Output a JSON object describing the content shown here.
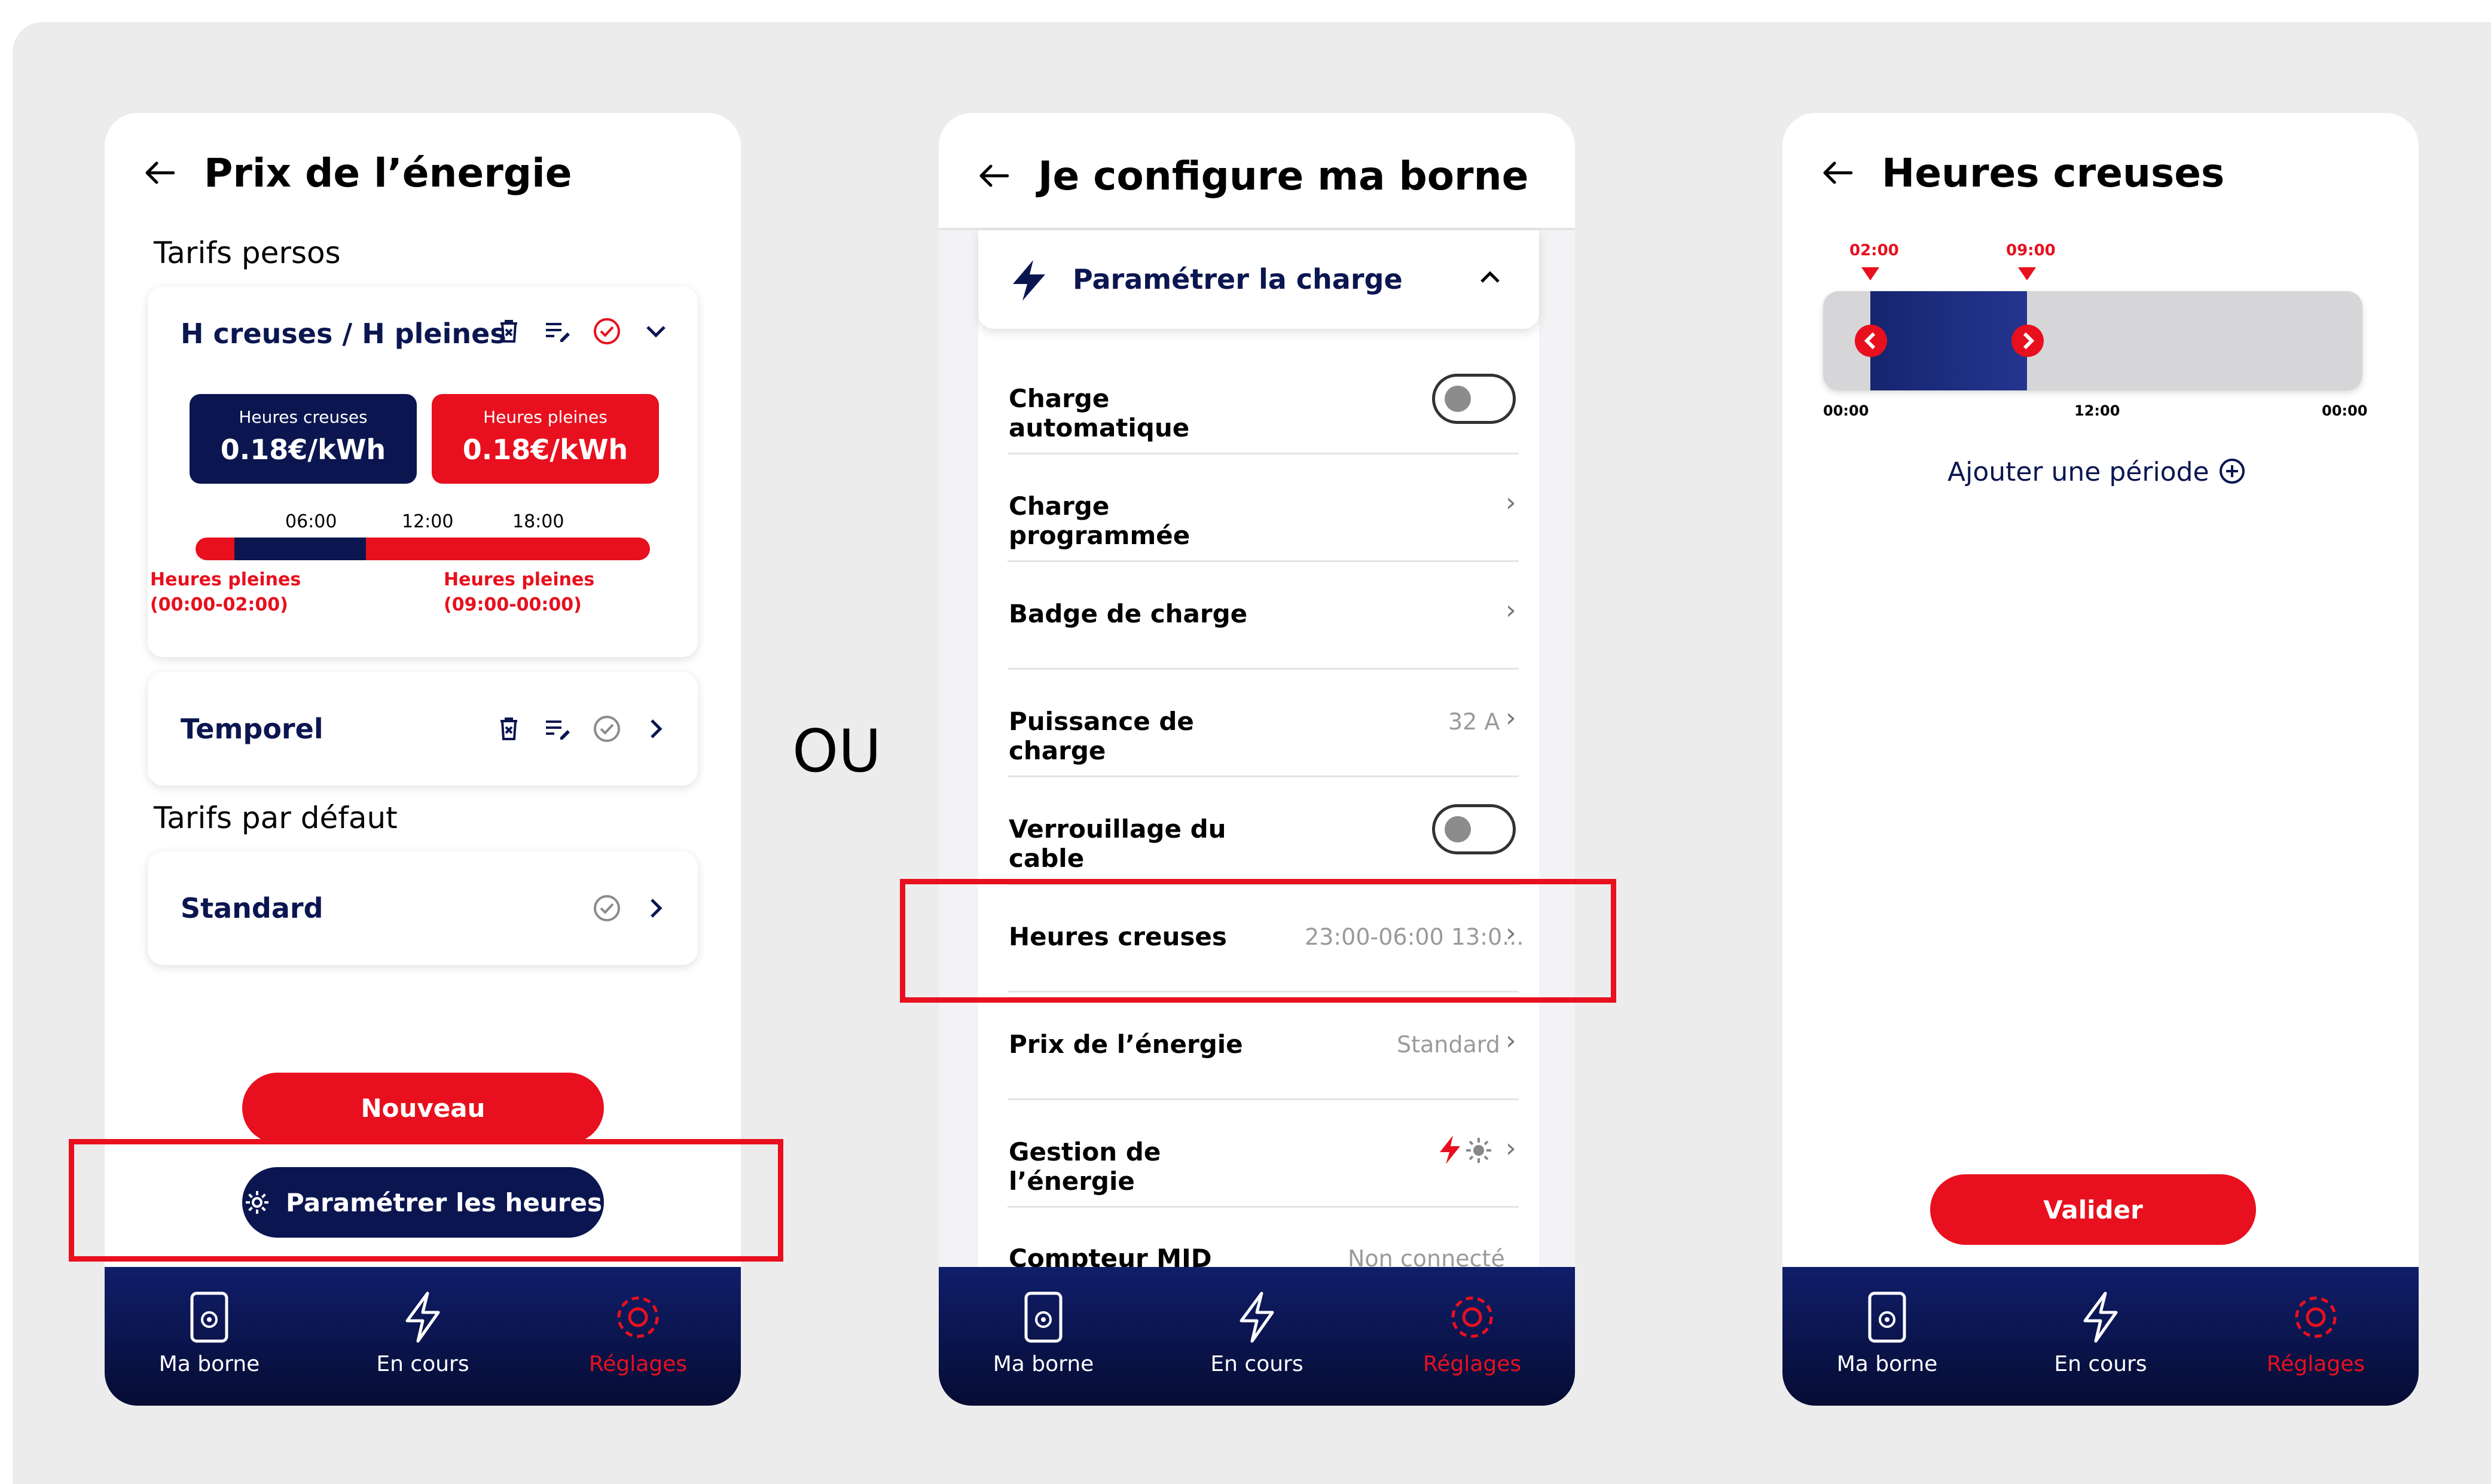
{
  "separator": "OU",
  "colors": {
    "navy": "#0b1650",
    "red": "#e8101e",
    "bar_grey": "#d6d6d8",
    "bg": "#ececed"
  },
  "nav": {
    "home": "Ma borne",
    "current": "En cours",
    "settings": "Réglages",
    "active": "settings"
  },
  "screen1": {
    "title": "Prix de l’énergie",
    "section_perso": "Tarifs persos",
    "card1": {
      "title": "H creuses / H pleines",
      "icons": [
        "delete-icon",
        "edit-list-icon",
        "check-circle-icon",
        "chevron-down-icon"
      ],
      "selected": true,
      "tile_creuses": {
        "label": "Heures creuses",
        "value": "0.18€/kWh"
      },
      "tile_pleines": {
        "label": "Heures pleines",
        "value": "0.18€/kWh"
      },
      "scale": [
        "06:00",
        "12:00",
        "18:00"
      ],
      "note_left": [
        "Heures pleines",
        "(00:00-02:00)"
      ],
      "note_right": [
        "Heures pleines",
        "(09:00-00:00)"
      ]
    },
    "card2": {
      "title": "Temporel",
      "icons": [
        "delete-icon",
        "edit-list-icon",
        "check-circle-icon",
        "chevron-right-icon"
      ]
    },
    "section_default": "Tarifs par défaut",
    "card3": {
      "title": "Standard",
      "icons": [
        "check-circle-icon",
        "chevron-right-icon"
      ]
    },
    "btn_new": "Nouveau",
    "btn_hours": "Paramétrer les heures"
  },
  "screen2": {
    "title": "Je configure ma borne",
    "section": "Paramétrer la charge",
    "rows": {
      "r1": {
        "label": "Charge automatique",
        "toggle": "off"
      },
      "r2": {
        "label": "Charge programmée"
      },
      "r3": {
        "label": "Badge de charge"
      },
      "r4": {
        "label": "Puissance de charge",
        "value": "32 A"
      },
      "r5": {
        "label": "Verrouillage du cable",
        "toggle": "off"
      },
      "r6": {
        "label": "Heures creuses",
        "value": "23:00-06:00 13:0..."
      },
      "r7": {
        "label": "Prix de l’énergie",
        "value": "Standard"
      },
      "r8": {
        "label": "Gestion de l’énergie",
        "value_icons": [
          "lightning-icon",
          "sun-icon"
        ]
      },
      "r9": {
        "label": "Compteur MID",
        "value": "Non connecté"
      }
    }
  },
  "screen3": {
    "title": "Heures creuses",
    "marker_start": "02:00",
    "marker_end": "09:00",
    "scale": [
      "00:00",
      "12:00",
      "00:00"
    ],
    "add_period": "Ajouter une période",
    "btn_validate": "Valider"
  }
}
